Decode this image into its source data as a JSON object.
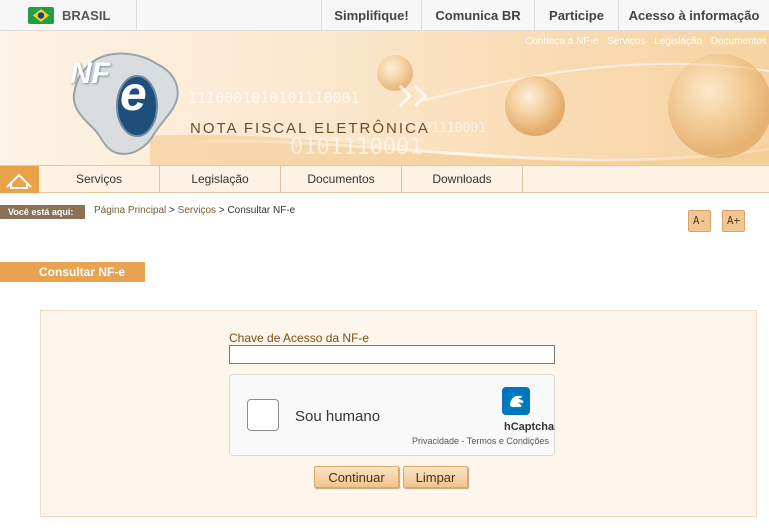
{
  "gov_bar": {
    "country": "BRASIL",
    "links": [
      "Simplifique!",
      "Comunica BR",
      "Participe",
      "Acesso à informação"
    ]
  },
  "banner": {
    "top_links": [
      "Conheça a NF-e",
      "Serviços",
      "Legislação",
      "Documentos"
    ],
    "logo_text_nf": "NF",
    "logo_text_e": "e",
    "title": "NOTA FISCAL ELETRÔNICA",
    "binary_1": "1110001010101110001",
    "binary_2": "01001110001",
    "binary_3": "0101110001"
  },
  "nav": {
    "items": [
      "Serviços",
      "Legislação",
      "Documentos",
      "Downloads"
    ]
  },
  "breadcrumb": {
    "label": "Você está aqui:",
    "items": [
      "Página Principal",
      "Serviços",
      "Consultar NF-e"
    ],
    "sep1": ">",
    "sep2": ">"
  },
  "font_controls": {
    "decrease": "A-",
    "increase": "A+"
  },
  "section": {
    "title": "Consultar NF-e"
  },
  "form": {
    "access_key_label": "Chave de Acesso da NF-e",
    "access_key_value": "",
    "captcha_label": "Sou humano",
    "captcha_brand": "hCaptcha",
    "captcha_links": "Privacidade - Termos e Condições",
    "submit_label": "Continuar",
    "clear_label": "Limpar"
  },
  "colors": {
    "accent": "#e8a252",
    "nav_bg": "#fdf2e3",
    "panel_bg": "#fdf6ec"
  }
}
